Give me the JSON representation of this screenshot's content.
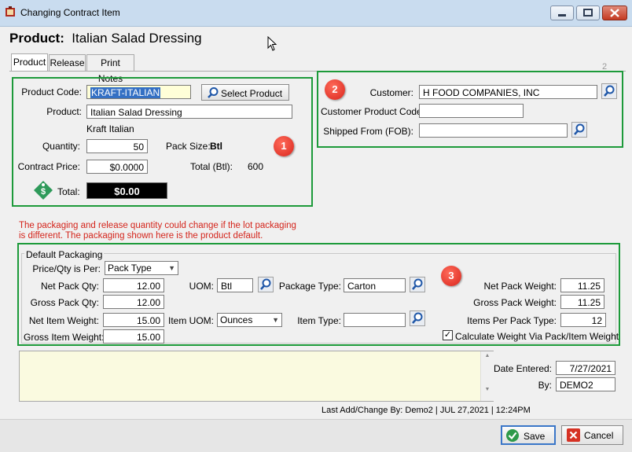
{
  "window": {
    "title": "Changing Contract Item"
  },
  "header": {
    "label": "Product",
    "colon": ":",
    "value": "Italian Salad Dressing"
  },
  "tabs": [
    {
      "label": "Product"
    },
    {
      "label": "Release"
    },
    {
      "label": "Print Notes"
    }
  ],
  "page_indicator": "2",
  "product": {
    "code_label": "Product Code:",
    "code_value": "KRAFT-ITALIAN",
    "select_label": "Select Product",
    "product_label": "Product:",
    "product_value": "Italian Salad Dressing",
    "brand": "Kraft Italian",
    "quantity_label": "Quantity:",
    "quantity_value": "50",
    "pack_size_label": "Pack Size:",
    "pack_size_value": "Btl",
    "price_label": "Contract Price:",
    "price_value": "$0.0000",
    "total_btl_label": "Total (Btl):",
    "total_btl_value": "600",
    "total_label": "Total:",
    "total_value": "$0.00"
  },
  "customer": {
    "customer_label": "Customer:",
    "customer_value": "H FOOD COMPANIES, INC",
    "cpc_label": "Customer Product Code:",
    "cpc_value": "",
    "fob_label": "Shipped From (FOB):",
    "fob_value": ""
  },
  "warning": "The packaging and release quantity could change if the lot packaging is different.  The packaging shown here is the product default.",
  "packaging": {
    "legend": "Default Packaging",
    "per_label": "Price/Qty is Per:",
    "per_value": "Pack Type",
    "net_pack_qty_label": "Net Pack Qty:",
    "net_pack_qty": "12.00",
    "gross_pack_qty_label": "Gross Pack Qty:",
    "gross_pack_qty": "12.00",
    "net_item_weight_label": "Net Item Weight:",
    "net_item_weight": "15.00",
    "gross_item_weight_label": "Gross Item Weight:",
    "gross_item_weight": "15.00",
    "uom_label": "UOM:",
    "uom_value": "Btl",
    "item_uom_label": "Item UOM:",
    "item_uom_value": "Ounces",
    "package_type_label": "Package Type:",
    "package_type_value": "Carton",
    "item_type_label": "Item Type:",
    "item_type_value": "",
    "net_pack_weight_label": "Net Pack Weight:",
    "net_pack_weight": "11.25",
    "gross_pack_weight_label": "Gross Pack Weight:",
    "gross_pack_weight": "11.25",
    "items_per_pack_label": "Items Per Pack Type:",
    "items_per_pack": "12",
    "calc_label": "Calculate Weight Via Pack/Item Weight",
    "calc_checked": "✓"
  },
  "badges": [
    "1",
    "2",
    "3"
  ],
  "footer": {
    "date_entered_label": "Date Entered:",
    "date_entered": "7/27/2021",
    "by_label": "By:",
    "by_value": "DEMO2",
    "last_change": "Last Add/Change By:  Demo2 | JUL 27,2021 | 12:24PM",
    "save_label": "Save",
    "cancel_label": "Cancel"
  },
  "colors": {
    "green_outline": "#1d9a3a",
    "warning_text": "#d4241b",
    "notes_bg": "#fafae0",
    "total_bg": "#000000"
  }
}
